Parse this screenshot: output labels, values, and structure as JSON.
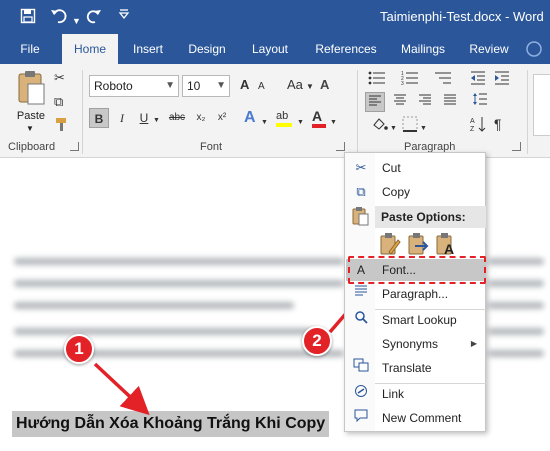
{
  "titlebar": {
    "doc_title": "Taimienphi-Test.docx - Word",
    "save_icon": "floppy-save-icon",
    "undo_icon": "undo-icon",
    "redo_icon": "redo-icon",
    "customize_icon": "customize-toolbar-icon"
  },
  "tabs": [
    "File",
    "Home",
    "Insert",
    "Design",
    "Layout",
    "References",
    "Mailings",
    "Review"
  ],
  "ribbon": {
    "clipboard": {
      "paste_label": "Paste",
      "group_label": "Clipboard"
    },
    "font": {
      "font_name": "Roboto",
      "font_size": "10",
      "group_label": "Font",
      "bold": "B",
      "italic": "I",
      "underline": "U",
      "strikethrough": "abc",
      "subscript": "x₂",
      "superscript": "x²",
      "grow": "A",
      "shrink": "A",
      "change_case": "Aa",
      "clear_format": "A",
      "text_effects": "A",
      "highlight": "ab",
      "font_color": "A"
    },
    "paragraph": {
      "group_label": "Paragraph"
    }
  },
  "document": {
    "selected_heading": "Hướng Dẫn Xóa Khoảng Trắng Khi Copy"
  },
  "context_menu": {
    "cut": "Cut",
    "copy": "Copy",
    "paste_options": "Paste Options:",
    "font": "Font...",
    "paragraph": "Paragraph...",
    "smart_lookup": "Smart Lookup",
    "synonyms": "Synonyms",
    "translate": "Translate",
    "link": "Link",
    "new_comment": "New Comment"
  },
  "badges": {
    "step1": "1",
    "step2": "2"
  },
  "colors": {
    "word_blue": "#2b579a",
    "ribbon_bg": "#f3f3f3",
    "annotation_red": "#e32228"
  }
}
